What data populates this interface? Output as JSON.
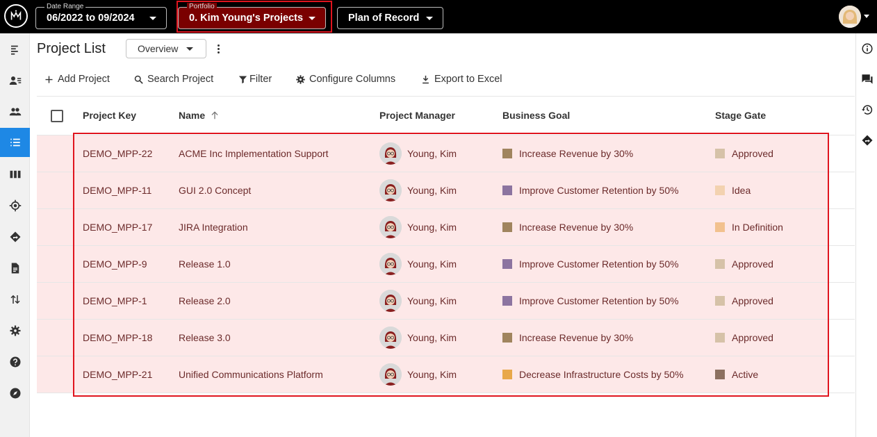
{
  "topbar": {
    "date_range": {
      "caption": "Date Range",
      "value": "06/2022 to 09/2024"
    },
    "portfolio": {
      "caption": "Portfolio",
      "value": "0. Kim Young's Projects"
    },
    "plan": {
      "value": "Plan of Record"
    }
  },
  "header": {
    "title": "Project List",
    "view": "Overview"
  },
  "toolbar": {
    "add": "Add Project",
    "search": "Search Project",
    "filter": "Filter",
    "configure": "Configure Columns",
    "export": "Export to Excel"
  },
  "table": {
    "columns": {
      "key": "Project Key",
      "name": "Name",
      "manager": "Project Manager",
      "goal": "Business Goal",
      "stage": "Stage Gate"
    },
    "rows": [
      {
        "key": "DEMO_MPP-22",
        "name": "ACME Inc Implementation Support",
        "manager": "Young, Kim",
        "goal": "Increase Revenue by 30%",
        "goal_color": "#a0845e",
        "stage": "Approved",
        "stage_color": "#d6c2a8"
      },
      {
        "key": "DEMO_MPP-11",
        "name": "GUI 2.0 Concept",
        "manager": "Young, Kim",
        "goal": "Improve Customer Retention by 50%",
        "goal_color": "#8c74a0",
        "stage": "Idea",
        "stage_color": "#f3d2b0"
      },
      {
        "key": "DEMO_MPP-17",
        "name": "JIRA Integration",
        "manager": "Young, Kim",
        "goal": "Increase Revenue by 30%",
        "goal_color": "#a0845e",
        "stage": "In Definition",
        "stage_color": "#f2c18e"
      },
      {
        "key": "DEMO_MPP-9",
        "name": "Release 1.0",
        "manager": "Young, Kim",
        "goal": "Improve Customer Retention by 50%",
        "goal_color": "#8c74a0",
        "stage": "Approved",
        "stage_color": "#d6c2a8"
      },
      {
        "key": "DEMO_MPP-1",
        "name": "Release 2.0",
        "manager": "Young, Kim",
        "goal": "Improve Customer Retention by 50%",
        "goal_color": "#8c74a0",
        "stage": "Approved",
        "stage_color": "#d6c2a8"
      },
      {
        "key": "DEMO_MPP-18",
        "name": "Release 3.0",
        "manager": "Young, Kim",
        "goal": "Increase Revenue by 30%",
        "goal_color": "#a0845e",
        "stage": "Approved",
        "stage_color": "#d6c2a8"
      },
      {
        "key": "DEMO_MPP-21",
        "name": "Unified Communications Platform",
        "manager": "Young, Kim",
        "goal": "Decrease Infrastructure Costs by 50%",
        "goal_color": "#e8a84a",
        "stage": "Active",
        "stage_color": "#8c7060"
      }
    ]
  },
  "colors": {
    "accent": "#1e88e5",
    "highlight_border": "#e0141e",
    "row_highlight": "#fde8e8",
    "portfolio_bg": "#7a0000"
  },
  "icons": {
    "left": [
      "menu-collapse-icon",
      "assign-users-icon",
      "people-icon",
      "list-icon",
      "columns-icon",
      "target-icon",
      "directions-icon",
      "document-icon",
      "swap-vert-icon",
      "settings-icon",
      "help-icon",
      "compass-icon"
    ],
    "right": [
      "info-icon",
      "chat-icon",
      "history-icon",
      "directions-icon"
    ]
  }
}
